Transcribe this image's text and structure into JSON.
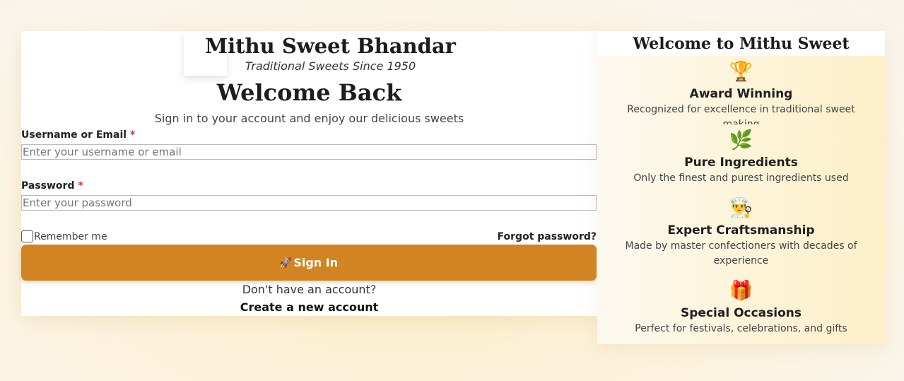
{
  "brand": {
    "name": "Mithu Sweet Bhandar",
    "tagline": "Traditional Sweets Since 1950"
  },
  "login": {
    "heading": "Welcome Back",
    "subheading": "Sign in to your account and enjoy our delicious sweets",
    "username_label": "Username or Email",
    "username_placeholder": "Enter your username or email",
    "username_value": "",
    "password_label": "Password",
    "password_placeholder": "Enter your password",
    "password_value": "",
    "required_mark": "*",
    "remember_label": "Remember me",
    "remember_checked": false,
    "forgot_label": "Forgot password?",
    "signin_label": "Sign In",
    "no_account_text": "Don't have an account?",
    "create_account_label": "Create a new account"
  },
  "icons": {
    "username": "👤",
    "password": "🔒",
    "signin": "🚀"
  },
  "panel": {
    "title": "Welcome to Mithu Sweet Bhandar",
    "features": [
      {
        "icon": "🏆",
        "icon_name": "trophy-icon",
        "title": "Award Winning",
        "desc": "Recognized for excellence in traditional sweet making"
      },
      {
        "icon": "🌿",
        "icon_name": "herb-icon",
        "title": "Pure Ingredients",
        "desc": "Only the finest and purest ingredients used"
      },
      {
        "icon": "👨‍🍳",
        "icon_name": "chef-icon",
        "title": "Expert Craftsmanship",
        "desc": "Made by master confectioners with decades of experience"
      },
      {
        "icon": "🎁",
        "icon_name": "gift-icon",
        "title": "Special Occasions",
        "desc": "Perfect for festivals, celebrations, and gifts"
      }
    ]
  },
  "colors": {
    "accent": "#d28423",
    "required": "#d0302f",
    "panel_bg": "#fdf3d6"
  }
}
